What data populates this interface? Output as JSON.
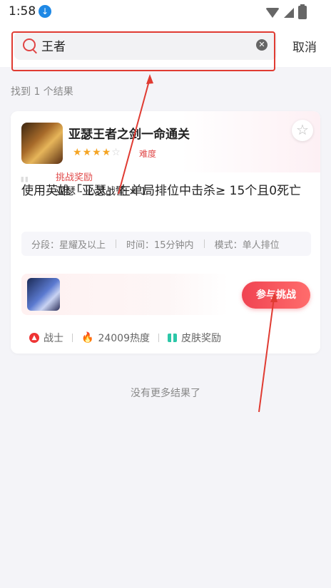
{
  "status_bar": {
    "time": "1:58"
  },
  "search": {
    "query": "王者",
    "cancel_label": "取消"
  },
  "results": {
    "count_text": "找到 1 个结果",
    "end_text": "没有更多结果了"
  },
  "card": {
    "title": "亚瑟王者之剑一命通关",
    "rating": 4,
    "rating_max": 5,
    "difficulty_label": "难度",
    "description": "使用英雄「亚瑟」在单局排位中击杀≥ 15个且0死亡",
    "info": {
      "rank": "分段：星耀及以上",
      "time": "时间：15分钟内",
      "mode": "模式：单人排位"
    },
    "reward": {
      "label": "挑战奖励",
      "item": "亚瑟 - 心灵战警 × 1"
    },
    "join_label": "参与挑战",
    "tags": {
      "role": "战士",
      "heat": "24009热度",
      "reward_type": "皮肤奖励"
    }
  },
  "colors": {
    "accent": "#e04a4a",
    "annotation": "#e03b32",
    "star": "#f5a524"
  }
}
